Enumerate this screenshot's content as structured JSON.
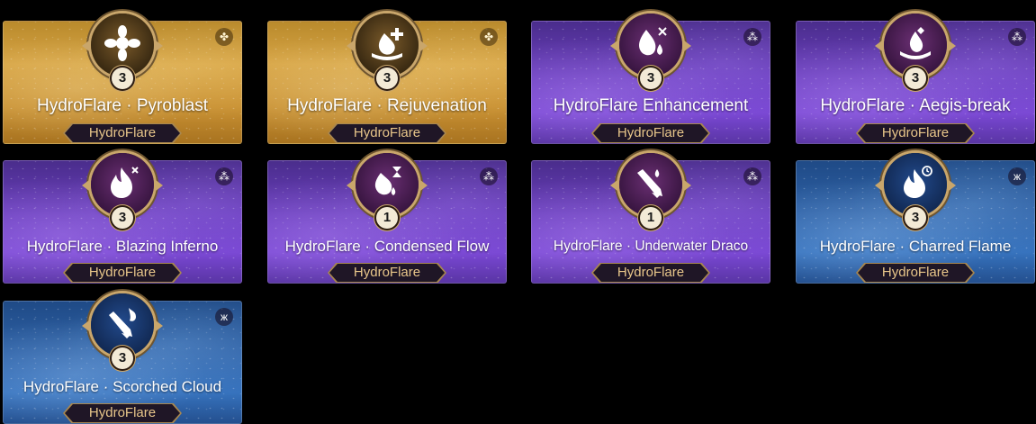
{
  "cards": [
    {
      "title": "HydroFlare · Pyroblast",
      "tag": "HydroFlare",
      "level": "3",
      "rarity": "gold",
      "rarity_icon": "clover-icon",
      "skill_icon": "blossom-burst-icon"
    },
    {
      "title": "HydroFlare · Rejuvenation",
      "tag": "HydroFlare",
      "level": "3",
      "rarity": "gold",
      "rarity_icon": "clover-icon",
      "skill_icon": "heal-plus-icon"
    },
    {
      "title": "HydroFlare Enhancement",
      "tag": "HydroFlare",
      "level": "3",
      "rarity": "purple",
      "rarity_icon": "triad-icon",
      "skill_icon": "water-drop-boost-icon"
    },
    {
      "title": "HydroFlare · Aegis-break",
      "tag": "HydroFlare",
      "level": "3",
      "rarity": "purple",
      "rarity_icon": "triad-icon",
      "skill_icon": "shield-break-icon"
    },
    {
      "title": "HydroFlare · Blazing Inferno",
      "tag": "HydroFlare",
      "level": "3",
      "rarity": "purple",
      "rarity_icon": "triad-icon",
      "skill_icon": "flame-icon"
    },
    {
      "title": "HydroFlare · Condensed Flow",
      "tag": "HydroFlare",
      "level": "1",
      "rarity": "purple",
      "rarity_icon": "triad-icon",
      "skill_icon": "hourglass-drop-icon"
    },
    {
      "title": "HydroFlare · Underwater Draco",
      "tag": "HydroFlare",
      "level": "1",
      "rarity": "purple",
      "rarity_icon": "triad-icon",
      "skill_icon": "dragon-strike-icon"
    },
    {
      "title": "HydroFlare · Charred Flame",
      "tag": "HydroFlare",
      "level": "3",
      "rarity": "blue",
      "rarity_icon": "butterfly-icon",
      "skill_icon": "clock-flame-icon"
    },
    {
      "title": "HydroFlare · Scorched Cloud",
      "tag": "HydroFlare",
      "level": "3",
      "rarity": "blue",
      "rarity_icon": "butterfly-icon",
      "skill_icon": "cloud-strike-icon"
    }
  ],
  "colors": {
    "gold": "#c99133",
    "purple": "#6b3fbf",
    "blue": "#2f63a8",
    "tag_text": "#e8c68a"
  }
}
